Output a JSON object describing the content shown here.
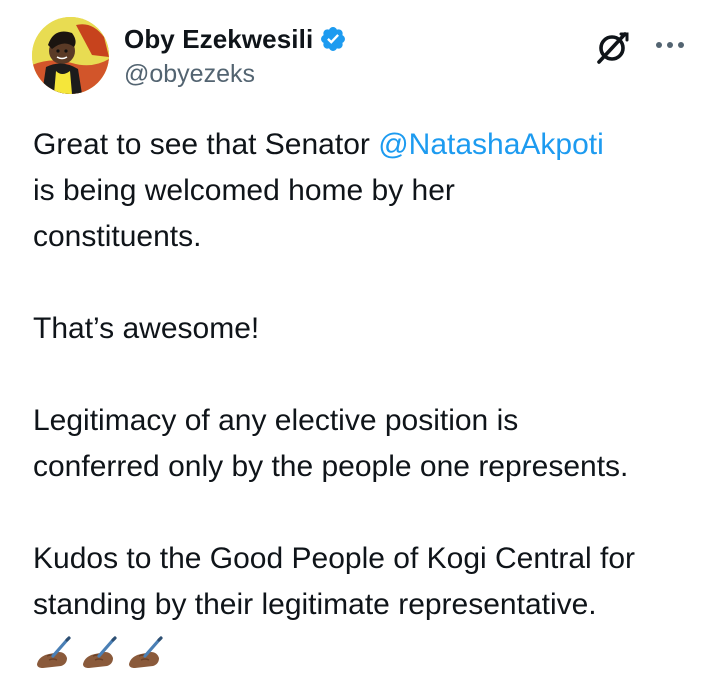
{
  "author": {
    "display_name": "Oby Ezekwesili",
    "handle": "@obyezeks",
    "verified_icon": "verified-badge-icon",
    "verified_color": "#1d9bf0"
  },
  "actions": {
    "grok_icon": "grok-icon",
    "more_icon": "more-options-icon"
  },
  "tweet": {
    "line1_prefix": "Great to see that Senator ",
    "mention": "@NatashaAkpoti",
    "line2": "is being welcomed home by her",
    "line3": "constituents.",
    "para2": "That’s awesome!",
    "para3_line1": "Legitimacy of any elective position is",
    "para3_line2": "conferred only by the people one represents.",
    "para4_line1": "Kudos to the Good People of Kogi Central for",
    "para4_line2": "standing by their legitimate representative.",
    "emojis": [
      "writing-hand-icon",
      "writing-hand-icon",
      "writing-hand-icon"
    ]
  },
  "colors": {
    "text": "#0f1419",
    "secondary": "#536471",
    "mention": "#1d9bf0"
  }
}
